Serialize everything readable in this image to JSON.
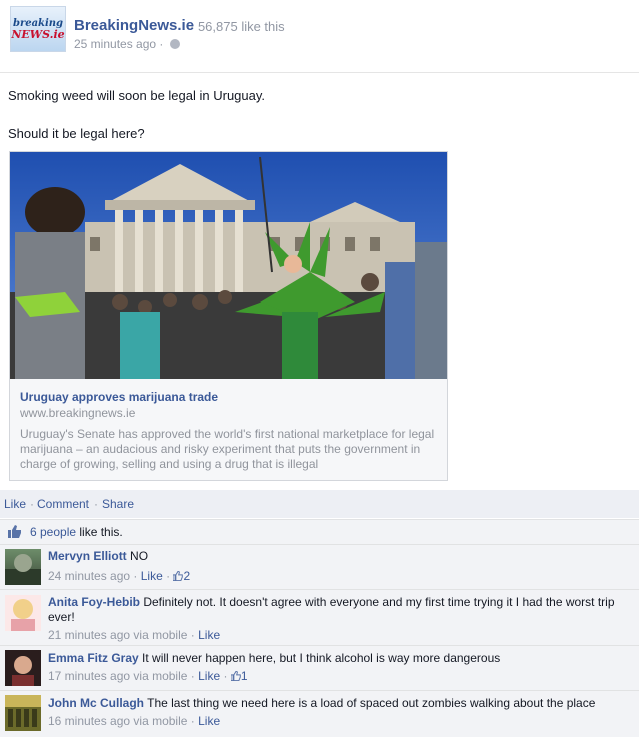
{
  "page": {
    "logo_line1": "breaking",
    "logo_line2": "NEWS.ie",
    "name": "BreakingNews.ie",
    "likes": "· 56,875 like this",
    "time": "25 minutes ago ·"
  },
  "post": {
    "line1": "Smoking weed will soon be legal in Uruguay.",
    "line2": "Should it be legal here?"
  },
  "attachment": {
    "title": "Uruguay approves marijuana trade",
    "domain": "www.breakingnews.ie",
    "description": "Uruguay's Senate has approved the world's first national marketplace for legal marijuana – an audacious and risky experiment that puts the government in charge of growing, selling and using a drug that is illegal"
  },
  "actions": {
    "like": "Like",
    "comment": "Comment",
    "share": "Share",
    "sep": "·"
  },
  "likes_summary": {
    "people": "6 people",
    "suffix": " like this."
  },
  "comments": [
    {
      "author": "Mervyn Elliott",
      "text": " NO",
      "time": "24 minutes ago",
      "via": "",
      "like": "Like",
      "likes": "2"
    },
    {
      "author": "Anita Foy-Hebib",
      "text": " Definitely not. It doesn't agree with everyone and my first time trying it I had the worst trip ever!",
      "time": "21 minutes ago",
      "via": " via mobile",
      "like": "Like",
      "likes": ""
    },
    {
      "author": "Emma Fitz Gray",
      "text": " It will never happen here, but I think alcohol is way more dangerous",
      "time": "17 minutes ago",
      "via": " via mobile",
      "like": "Like",
      "likes": "1"
    },
    {
      "author": "John Mc Cullagh",
      "text": " The last thing we need here is a load of spaced out zombies walking about the place",
      "time": "16 minutes ago",
      "via": " via mobile",
      "like": "Like",
      "likes": ""
    }
  ],
  "colors": {
    "link": "#3b5998",
    "muted": "#9197a3",
    "ufi_bg": "#f2f3f6"
  }
}
